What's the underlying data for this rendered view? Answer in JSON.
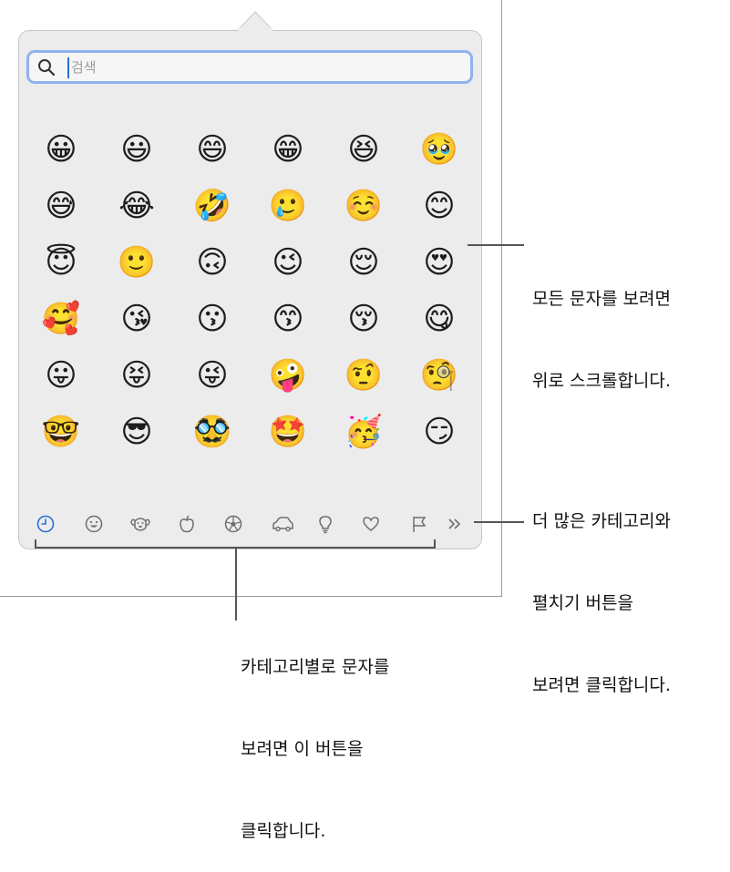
{
  "search": {
    "placeholder": "검색"
  },
  "emoji_rows": [
    [
      "😀",
      "😃",
      "😄",
      "😁",
      "😆",
      "🥹"
    ],
    [
      "😅",
      "😂",
      "🤣",
      "🥲",
      "☺️",
      "😊"
    ],
    [
      "😇",
      "🙂",
      "🙃",
      "😉",
      "😌",
      "😍"
    ],
    [
      "🥰",
      "😘",
      "😗",
      "😙",
      "😚",
      "😋"
    ],
    [
      "😛",
      "😝",
      "😜",
      "🤪",
      "🤨",
      "🧐"
    ],
    [
      "🤓",
      "😎",
      "🥸",
      "🤩",
      "🥳",
      "😏"
    ]
  ],
  "categories": [
    "frequently-used",
    "smileys-people",
    "animals-nature",
    "food-drink",
    "activity",
    "travel-places",
    "objects",
    "symbols",
    "flags",
    "more"
  ],
  "callouts": {
    "scroll": [
      "모든 문자를 보려면",
      "위로 스크롤합니다."
    ],
    "more": [
      "더 많은 카테고리와",
      "펼치기 버튼을",
      "보려면 클릭합니다."
    ],
    "category": [
      "카테고리별로 문자를",
      "보려면 이 버튼을",
      "클릭합니다."
    ]
  },
  "colors": {
    "accent": "#2a6fd6",
    "search_border": "#8eb3ec",
    "popover_bg": "#ececec",
    "icon_gray": "#6e6e6e"
  }
}
